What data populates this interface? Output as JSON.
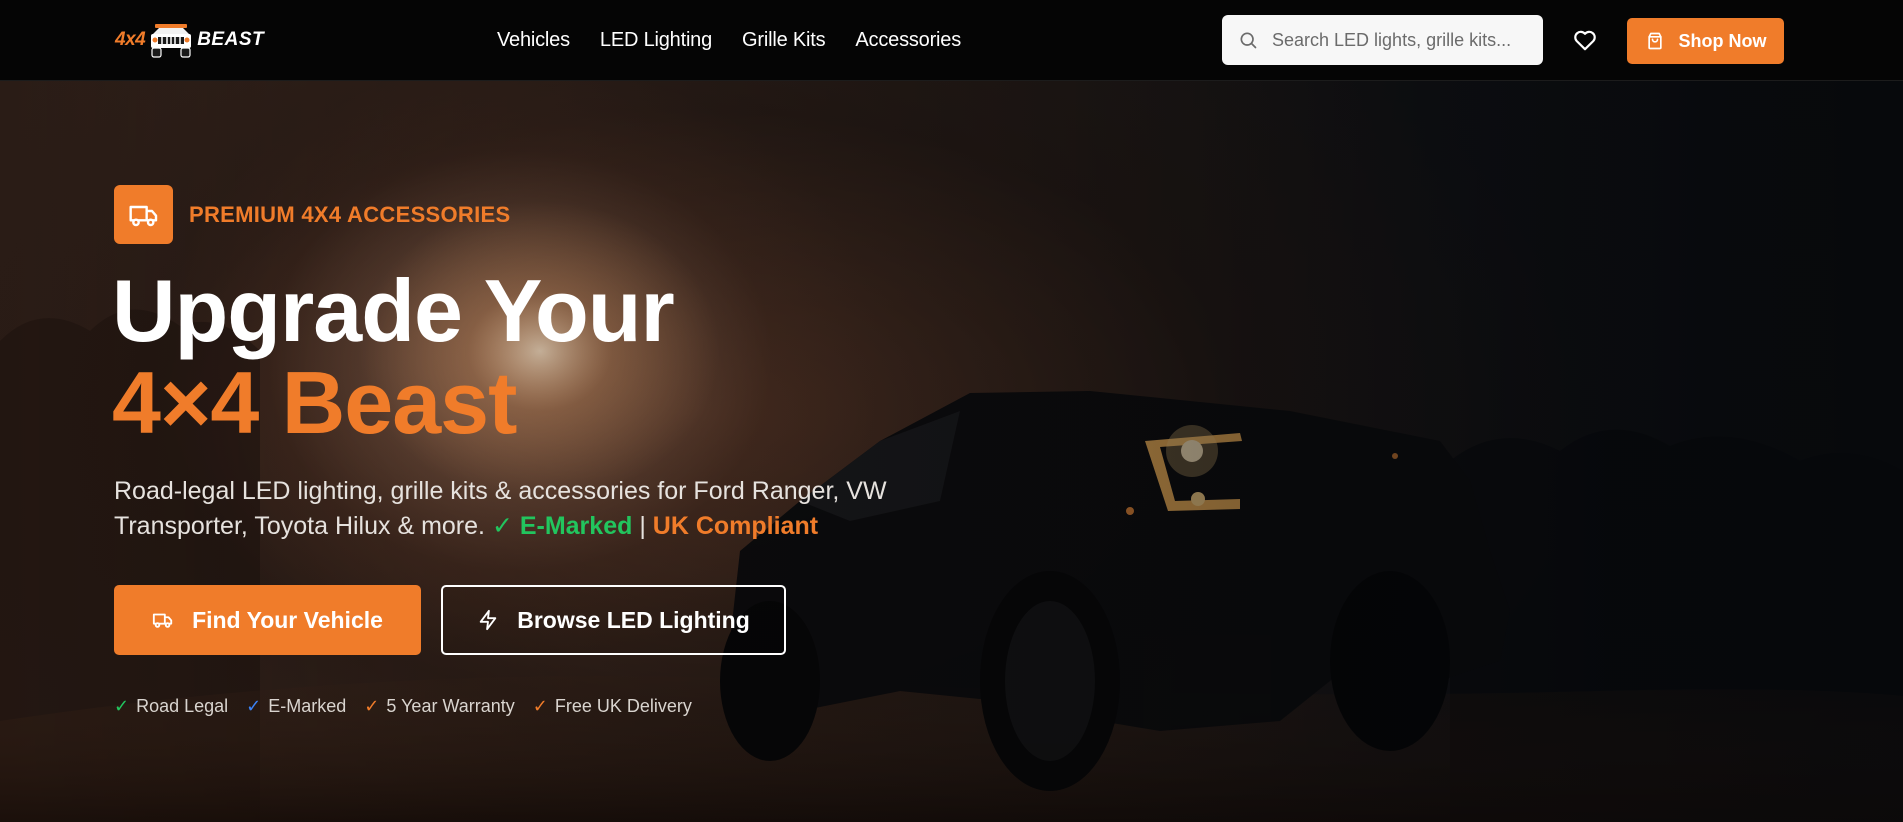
{
  "brand": {
    "logo_left": "4x4",
    "logo_right": "BEAST",
    "accent": "#f07c2a"
  },
  "nav": {
    "items": [
      {
        "label": "Vehicles"
      },
      {
        "label": "LED Lighting"
      },
      {
        "label": "Grille Kits"
      },
      {
        "label": "Accessories"
      }
    ]
  },
  "search": {
    "placeholder": "Search LED lights, grille kits...",
    "icon": "search-icon"
  },
  "header_actions": {
    "wishlist_icon": "heart-icon",
    "shop_label": "Shop Now",
    "shop_icon": "shopping-bag-icon"
  },
  "hero": {
    "badge_text": "PREMIUM 4X4 ACCESSORIES",
    "badge_icon": "truck-icon",
    "title_line1": "Upgrade Your",
    "title_line2": "4×4 Beast",
    "description": "Road-legal LED lighting, grille kits & accessories for Ford Ranger, VW Transporter, Toyota Hilux & more.",
    "emarked": "✓ E-Marked",
    "separator": "|",
    "uk_compliant": "UK Compliant",
    "primary_button": "Find Your Vehicle",
    "secondary_button": "Browse LED Lighting",
    "features": [
      {
        "check": "✓",
        "label": "Road Legal",
        "color": "#22c55e"
      },
      {
        "check": "✓",
        "label": "E-Marked",
        "color": "#3b82f6"
      },
      {
        "check": "✓",
        "label": "5 Year Warranty",
        "color": "#f07c2a"
      },
      {
        "check": "✓",
        "label": "Free UK Delivery",
        "color": "#f07c2a"
      }
    ]
  },
  "colors": {
    "header_bg": "#050505",
    "green": "#22c55e",
    "blue": "#3b82f6",
    "orange": "#f07c2a"
  }
}
